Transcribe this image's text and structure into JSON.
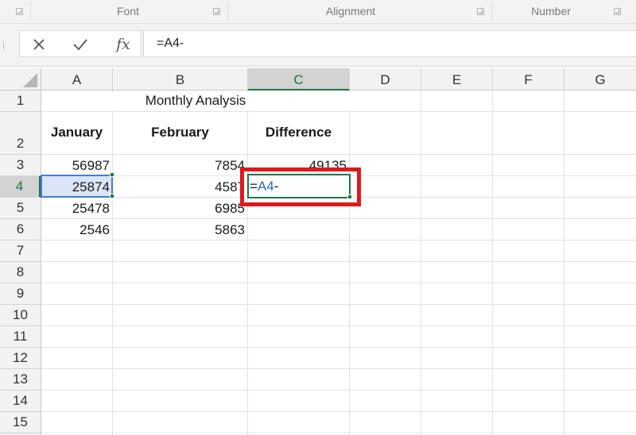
{
  "ribbon": {
    "groups": [
      {
        "label": "Font"
      },
      {
        "label": "Alignment"
      },
      {
        "label": "Number"
      }
    ]
  },
  "formula_bar": {
    "cancel_icon": "close-icon",
    "enter_icon": "check-icon",
    "function_label": "fx",
    "formula": "=A4-"
  },
  "columns": [
    "A",
    "B",
    "C",
    "D",
    "E",
    "F",
    "G"
  ],
  "rows": [
    "1",
    "2",
    "3",
    "4",
    "5",
    "6",
    "7",
    "8",
    "9",
    "10",
    "11",
    "12",
    "13",
    "14",
    "15"
  ],
  "sheet": {
    "title": "Monthly Analysis",
    "headers": {
      "january": "January",
      "february": "February",
      "difference": "Difference"
    },
    "data": [
      {
        "a": "56987",
        "b": "7854",
        "c": "49135"
      },
      {
        "a": "25874",
        "b": "4587",
        "c": ""
      },
      {
        "a": "25478",
        "b": "6985",
        "c": ""
      },
      {
        "a": "2546",
        "b": "5863",
        "c": ""
      }
    ],
    "editing_cell": {
      "prefix": "=",
      "reference": "A4",
      "suffix": "-"
    }
  },
  "colors": {
    "accent_green": "#217346",
    "reference_blue": "#2a66c8",
    "highlight_red": "#e0191f"
  }
}
